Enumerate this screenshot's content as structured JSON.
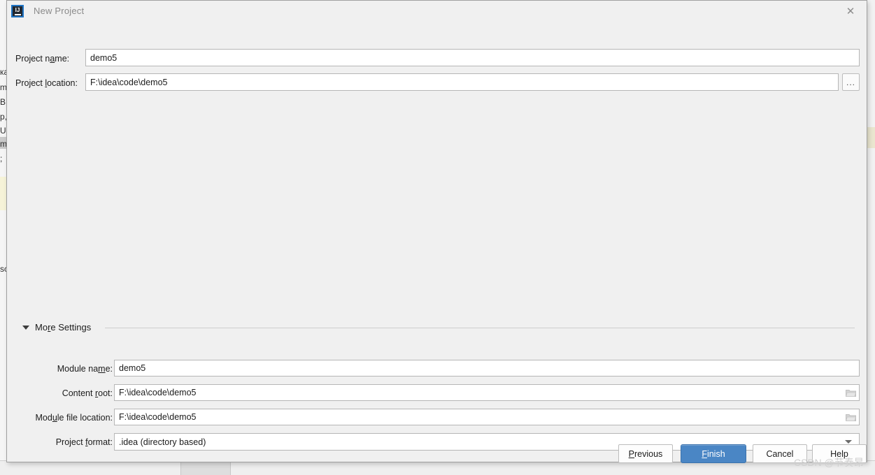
{
  "window": {
    "title": "New Project",
    "app_icon": "intellij-idea-icon",
    "close_icon": "close-icon"
  },
  "main_fields": [
    {
      "label_before": "Project n",
      "label_mnemonic": "a",
      "label_after": "me:",
      "value": "demo5",
      "name": "project-name"
    },
    {
      "label_before": "Project ",
      "label_mnemonic": "l",
      "label_after": "ocation:",
      "value": "F:\\idea\\code\\demo5",
      "name": "project-location"
    }
  ],
  "browse_button": {
    "label": "...",
    "name": "browse-button"
  },
  "more_settings": {
    "label_before": "Mo",
    "label_mnemonic": "r",
    "label_after": "e Settings",
    "expanded": true,
    "toggle_icon": "triangle-down-icon",
    "fields": [
      {
        "label_before": "Module na",
        "label_mnemonic": "m",
        "label_after": "e:",
        "value": "demo5",
        "name": "module-name",
        "trailing_icon": null
      },
      {
        "label_before": "Content ",
        "label_mnemonic": "r",
        "label_after": "oot:",
        "value": "F:\\idea\\code\\demo5",
        "name": "content-root",
        "trailing_icon": "folder-icon"
      },
      {
        "label_before": "Mod",
        "label_mnemonic": "u",
        "label_after": "le file location:",
        "value": "F:\\idea\\code\\demo5",
        "name": "module-file-location",
        "trailing_icon": "folder-icon"
      },
      {
        "label_before": "Project ",
        "label_mnemonic": "f",
        "label_after": "ormat:",
        "value": ".idea (directory based)",
        "name": "project-format",
        "trailing_icon": "chevron-down-icon"
      }
    ]
  },
  "buttons": [
    {
      "before": "",
      "mnemonic": "P",
      "after": "revious",
      "name": "previous-button",
      "primary": false
    },
    {
      "before": "",
      "mnemonic": "F",
      "after": "inish",
      "name": "finish-button",
      "primary": true
    },
    {
      "before": "Cancel",
      "mnemonic": "",
      "after": "",
      "name": "cancel-button",
      "primary": false
    },
    {
      "before": "Help",
      "mnemonic": "",
      "after": "",
      "name": "help-button",
      "primary": false
    }
  ],
  "watermark": {
    "text": "CSDN @节奏昂"
  },
  "background": {
    "left_fragments": [
      "ка",
      "m",
      "B",
      "p,",
      "U",
      "m",
      ";",
      "sс"
    ]
  },
  "colors": {
    "dialog_bg": "#f0f0f0",
    "accent_blue": "#4a86c5",
    "field_bg": "#ffffff",
    "field_border": "#b6b6b6",
    "title_text": "#8a8a8a",
    "text": "#1b1b1b"
  }
}
